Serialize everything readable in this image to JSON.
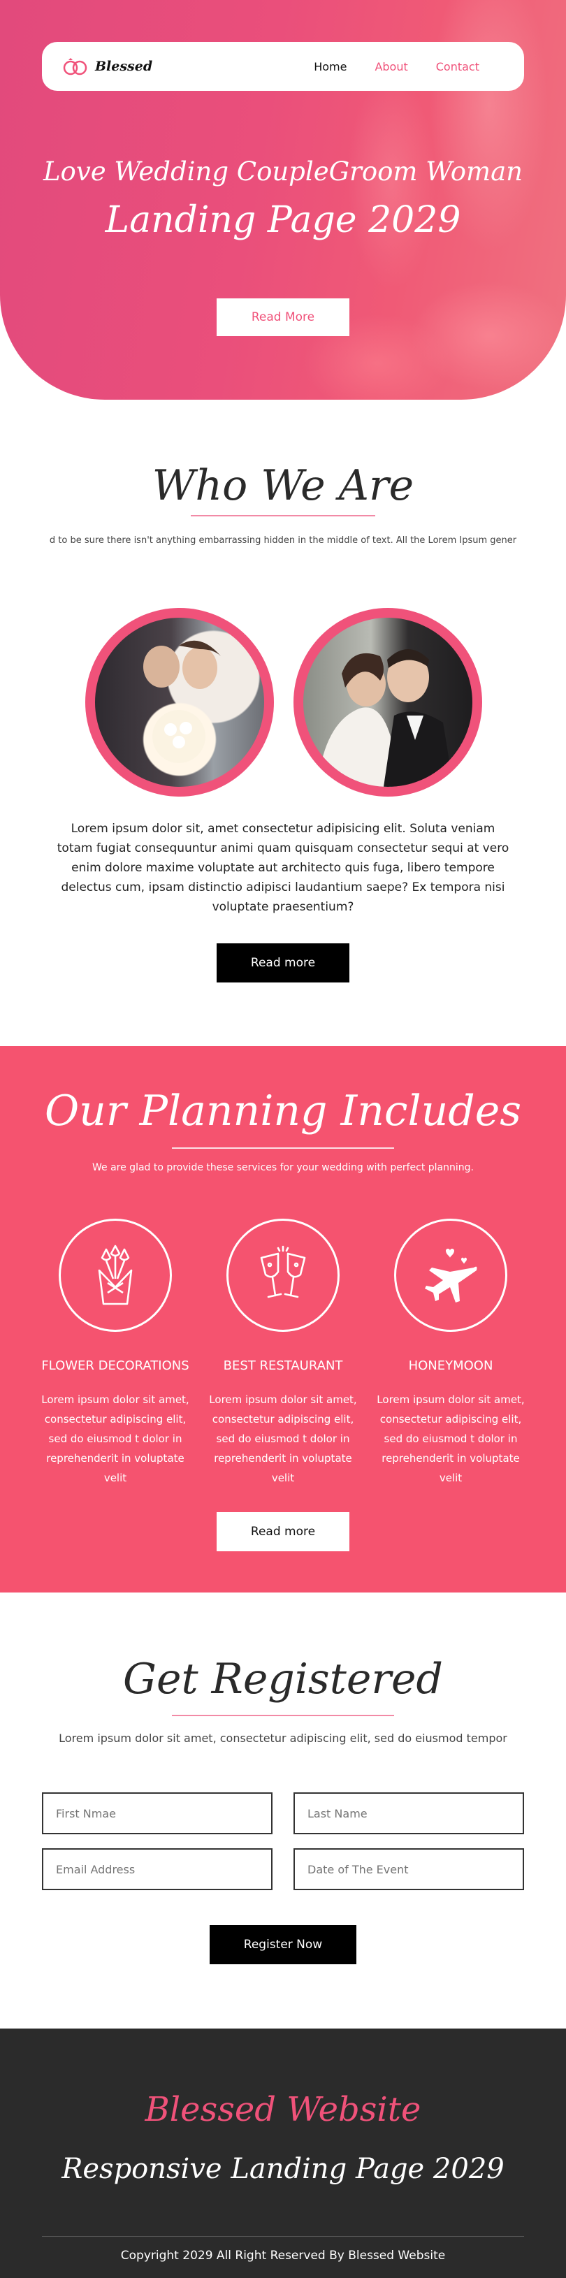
{
  "brand": {
    "name": "Blessed",
    "logo_icon": "rings-icon",
    "accent": "#f0527a"
  },
  "nav": {
    "items": [
      {
        "label": "Home",
        "active": true
      },
      {
        "label": "About"
      },
      {
        "label": "Contact"
      }
    ]
  },
  "hero": {
    "line1": "Love Wedding CoupleGroom Woman",
    "line2": "Landing Page 2029",
    "button": "Read More"
  },
  "who": {
    "title": "Who We Are",
    "subtitle": "d to be sure there isn't anything embarrassing hidden in the middle of text. All the Lorem Ipsum gener",
    "text": "Lorem ipsum dolor sit, amet consectetur adipisicing elit. Soluta veniam totam fugiat consequuntur animi quam quisquam consectetur sequi at vero enim dolore maxime voluptate aut architecto quis fuga, libero tempore delectus cum, ipsam distinctio adipisci laudantium saepe? Ex tempora nisi voluptate praesentium?",
    "button": "Read more"
  },
  "planning": {
    "title": "Our Planning Includes",
    "subtitle": "We are glad to provide these services for your wedding with perfect planning.",
    "services": [
      {
        "icon": "flower-bouquet-icon",
        "title": "FLOWER DECORATIONS",
        "text": "Lorem ipsum dolor sit amet, consectetur adipiscing elit, sed do eiusmod t dolor in reprehenderit in voluptate velit"
      },
      {
        "icon": "champagne-glasses-icon",
        "title": "BEST RESTAURANT",
        "text": "Lorem ipsum dolor sit amet, consectetur adipiscing elit, sed do eiusmod t dolor in reprehenderit in voluptate velit"
      },
      {
        "icon": "airplane-hearts-icon",
        "title": "HONEYMOON",
        "text": "Lorem ipsum dolor sit amet, consectetur adipiscing elit, sed do eiusmod t dolor in reprehenderit in voluptate velit"
      }
    ],
    "button": "Read more"
  },
  "register": {
    "title": "Get Registered",
    "subtitle": "Lorem ipsum dolor sit amet, consectetur adipiscing elit, sed do eiusmod tempor",
    "first_name_placeholder": "First Nmae",
    "last_name_placeholder": "Last Name",
    "email_placeholder": "Email Address",
    "date_placeholder": "Date of The Event",
    "button": "Register Now"
  },
  "footer": {
    "line1": "Blessed Website",
    "line2": "Responsive Landing Page 2029",
    "copyright": "Copyright 2029 All Right Reserved By Blessed Website"
  }
}
